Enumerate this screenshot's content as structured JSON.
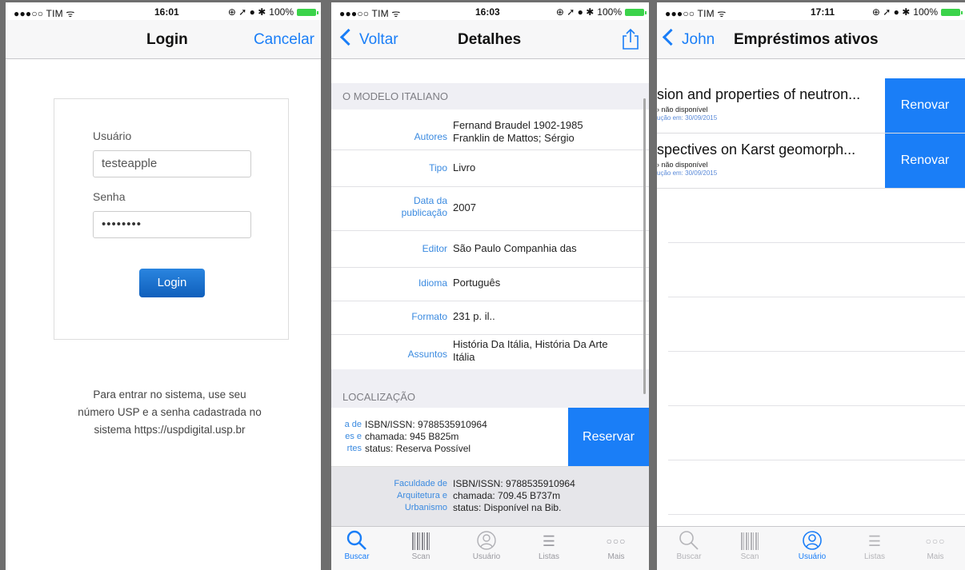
{
  "colors": {
    "accent": "#1a7ef7",
    "battery": "#3bd34a"
  },
  "screen1": {
    "status": {
      "carrier": "●●●○○ TIM ᯤ",
      "time": "16:01",
      "right_icons": "⊕ ➚ ● ✱",
      "battery": "100%"
    },
    "nav": {
      "title": "Login",
      "cancel": "Cancelar"
    },
    "form": {
      "user_label": "Usuário",
      "user_value": "testeapple",
      "password_label": "Senha",
      "password_value": "••••••••",
      "login_button": "Login"
    },
    "help_text": [
      "Para entrar no sistema, use seu",
      "número USP e a senha cadastrada no",
      "sistema https://uspdigital.usp.br"
    ]
  },
  "screen2": {
    "status": {
      "carrier": "●●●○○ TIM ᯤ",
      "time": "16:03",
      "right_icons": "⊕ ➚ ● ✱",
      "battery": "100%"
    },
    "nav": {
      "back": "Voltar",
      "title": "Detalhes",
      "share_icon": "share-icon"
    },
    "section_title": "O MODELO ITALIANO",
    "details": [
      {
        "key": "Autores",
        "value": "Fernand Braudel 1902-1985 Franklin de Mattos; Sérgio"
      },
      {
        "key": "Tipo",
        "value": "Livro"
      },
      {
        "key": "Data da publicação",
        "value": "2007"
      },
      {
        "key": "Editor",
        "value": "São Paulo Companhia das"
      },
      {
        "key": "Idioma",
        "value": "Português"
      },
      {
        "key": "Formato",
        "value": "231 p. il.."
      },
      {
        "key": "Assuntos",
        "value": "História Da Itália, História Da Arte Itália"
      }
    ],
    "location_header": "LOCALIZAÇÃO",
    "locations": [
      {
        "library": [
          "a de",
          "es e",
          "rtes"
        ],
        "isbn": "ISBN/ISSN: 9788535910964",
        "call": "chamada: 945 B825m",
        "status": "status: Reserva Possível",
        "action": "Reservar"
      },
      {
        "library": [
          "Faculdade de",
          "Arquitetura e",
          "Urbanismo"
        ],
        "isbn": "ISBN/ISSN: 9788535910964",
        "call": "chamada: 709.45 B737m",
        "status": "status: Disponível na Bib."
      }
    ],
    "tabs": [
      {
        "label": "Buscar",
        "icon": "search-icon",
        "active": true
      },
      {
        "label": "Scan",
        "icon": "barcode-icon"
      },
      {
        "label": "Usuário",
        "icon": "user-icon"
      },
      {
        "label": "Listas",
        "icon": "list-icon"
      },
      {
        "label": "Mais",
        "icon": "more-icon"
      }
    ]
  },
  "screen3": {
    "status": {
      "carrier": "●●●○○ TIM ᯤ",
      "time": "17:11",
      "right_icons": "⊕ ➚ ● ✱",
      "battery": "100%"
    },
    "nav": {
      "back": "John",
      "title": "Empréstimos ativos"
    },
    "loans": [
      {
        "title": "sion and properties of neutron...",
        "status": "› não disponível",
        "due": "ução em: 30/09/2015",
        "action": "Renovar"
      },
      {
        "title": "spectives on Karst geomorph...",
        "status": "› não disponível",
        "due": "ução em: 30/09/2015",
        "action": "Renovar"
      }
    ],
    "tabs": [
      {
        "label": "Buscar",
        "icon": "search-icon"
      },
      {
        "label": "Scan",
        "icon": "barcode-icon"
      },
      {
        "label": "Usuário",
        "icon": "user-icon",
        "active": true
      },
      {
        "label": "Listas",
        "icon": "list-icon"
      },
      {
        "label": "Mais",
        "icon": "more-icon"
      }
    ]
  }
}
